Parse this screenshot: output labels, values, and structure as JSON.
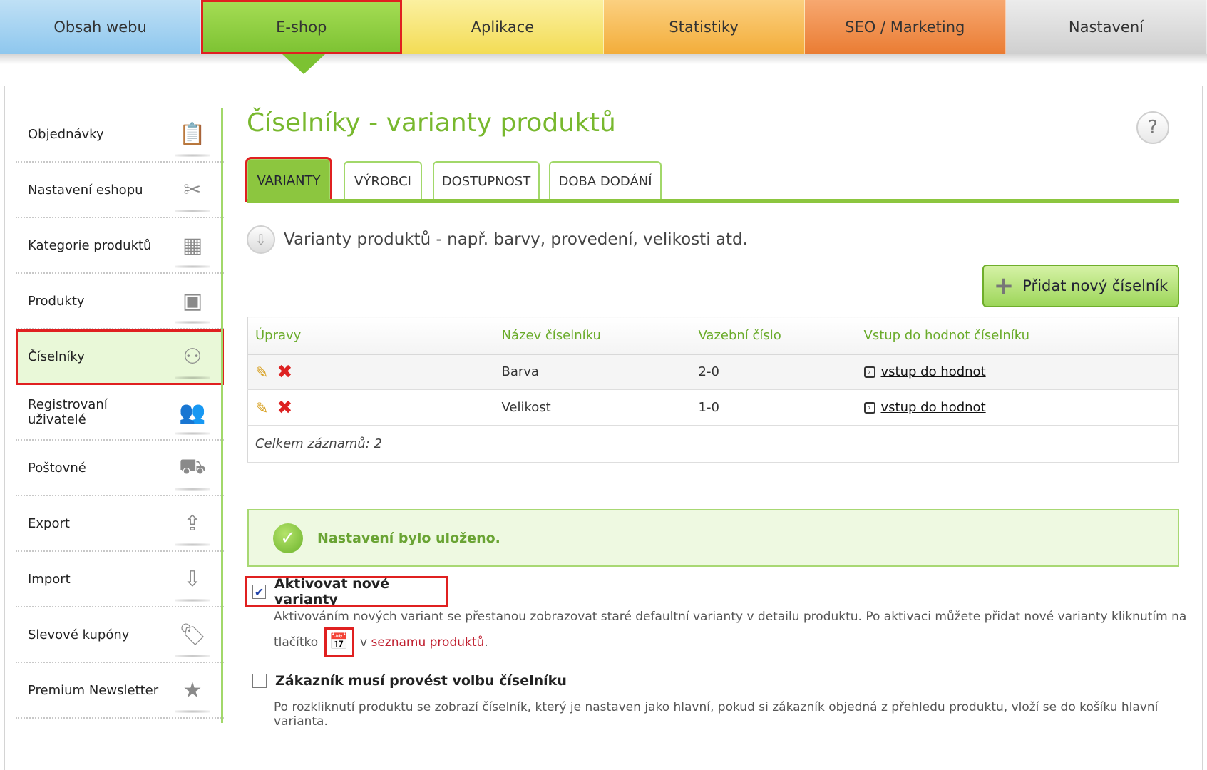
{
  "topnav": {
    "tabs": [
      {
        "label": "Obsah webu"
      },
      {
        "label": "E-shop"
      },
      {
        "label": "Aplikace"
      },
      {
        "label": "Statistiky"
      },
      {
        "label": "SEO / Marketing"
      },
      {
        "label": "Nastavení"
      }
    ]
  },
  "sidebar": {
    "items": [
      {
        "label": "Objednávky",
        "icon": "clipboard-icon",
        "glyph": "📋"
      },
      {
        "label": "Nastavení eshopu",
        "icon": "tools-icon",
        "glyph": "✂"
      },
      {
        "label": "Kategorie produktů",
        "icon": "folders-icon",
        "glyph": "▦"
      },
      {
        "label": "Produkty",
        "icon": "boxes-icon",
        "glyph": "▣"
      },
      {
        "label": "Číselníky",
        "icon": "balls-icon",
        "glyph": "⚇"
      },
      {
        "label": "Registrovaní uživatelé",
        "icon": "users-icon",
        "glyph": "👥"
      },
      {
        "label": "Poštovné",
        "icon": "truck-icon",
        "glyph": "⛟"
      },
      {
        "label": "Export",
        "icon": "upload-icon",
        "glyph": "⇪"
      },
      {
        "label": "Import",
        "icon": "download-icon",
        "glyph": "⇩"
      },
      {
        "label": "Slevové kupóny",
        "icon": "tag-icon",
        "glyph": "🏷"
      },
      {
        "label": "Premium Newsletter",
        "icon": "star-icon",
        "glyph": "★"
      }
    ]
  },
  "main": {
    "title": "Číselníky - varianty produktů",
    "help": "?",
    "tabs": [
      {
        "label": "VARIANTY"
      },
      {
        "label": "VÝROBCI"
      },
      {
        "label": "DOSTUPNOST"
      },
      {
        "label": "DOBA DODÁNÍ"
      }
    ],
    "section_heading": "Varianty produktů - např. barvy, provedení, velikosti atd.",
    "add_button": "Přidat nový číselník",
    "table": {
      "headers": [
        "Úpravy",
        "Název číselníku",
        "Vazební číslo",
        "Vstup do hodnot číselníku"
      ],
      "rows": [
        {
          "name": "Barva",
          "number": "2-0",
          "link": "vstup do hodnot"
        },
        {
          "name": "Velikost",
          "number": "1-0",
          "link": "vstup do hodnot"
        }
      ],
      "footer": "Celkem záznamů: 2"
    },
    "notice": "Nastavení bylo uloženo.",
    "options": {
      "activate_label": "Aktivovat nové varianty",
      "activate_desc_1": "Aktivováním nových variant se přestanou zobrazovat staré defaultní varianty v detailu produktu. Po aktivaci můžete přidat nové varianty kliknutím na",
      "activate_desc_2a": "tlačítko",
      "activate_desc_2b": "v",
      "activate_link": "seznamu produktů",
      "activate_desc_2c": ".",
      "customer_label": "Zákazník musí provést volbu číselníku",
      "customer_desc": "Po rozkliknutí produktu se zobrazí číselník, který je nastaven jako hlavní, pokud si zákazník objedná z přehledu produktu, vloží se do košíku hlavní varianta."
    }
  },
  "colors": {
    "accent_green": "#8cc63f",
    "title_green": "#78b82e",
    "highlight_red": "#e02020"
  }
}
